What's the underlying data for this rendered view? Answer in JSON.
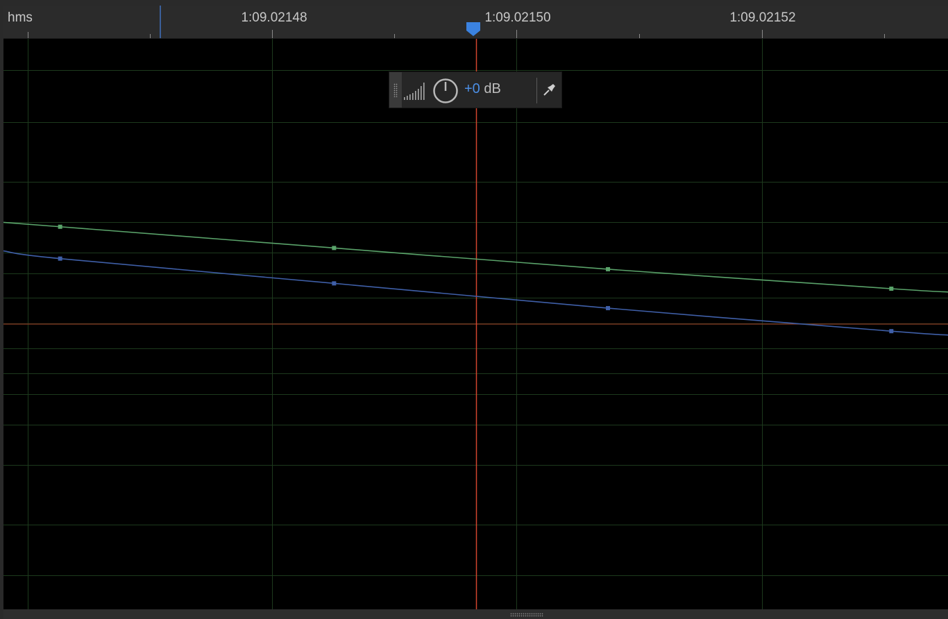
{
  "ruler": {
    "unit_label": "hms",
    "labels": [
      {
        "text": "1:09.02148"
      },
      {
        "text": "1:09.02150"
      },
      {
        "text": "1:09.02152"
      }
    ]
  },
  "hud": {
    "gain_value": "+0",
    "gain_unit": " dB",
    "icons": {
      "drag_handle": "grip-dots-icon",
      "level": "volume-bars-icon",
      "knob": "gain-knob-icon",
      "pin": "pin-icon"
    }
  },
  "colors": {
    "background": "#000000",
    "grid": "#1d3a1d",
    "playhead": "#d2452e",
    "zero_line": "#8a3a22",
    "curve_green": "#5aa36a",
    "curve_blue": "#3f5fa8",
    "ruler_bg": "#2b2b2b",
    "accent": "#4c8fe6"
  },
  "chart_data": {
    "type": "line",
    "series": [
      {
        "color_key": "curve_green",
        "points": [
          [
            0.06,
            0.55
          ],
          [
            0.35,
            0.43
          ],
          [
            0.64,
            0.31
          ],
          [
            0.94,
            0.2
          ]
        ]
      },
      {
        "color_key": "curve_blue",
        "points": [
          [
            0.06,
            0.37
          ],
          [
            0.35,
            0.23
          ],
          [
            0.64,
            0.09
          ],
          [
            0.94,
            -0.04
          ]
        ]
      }
    ]
  }
}
